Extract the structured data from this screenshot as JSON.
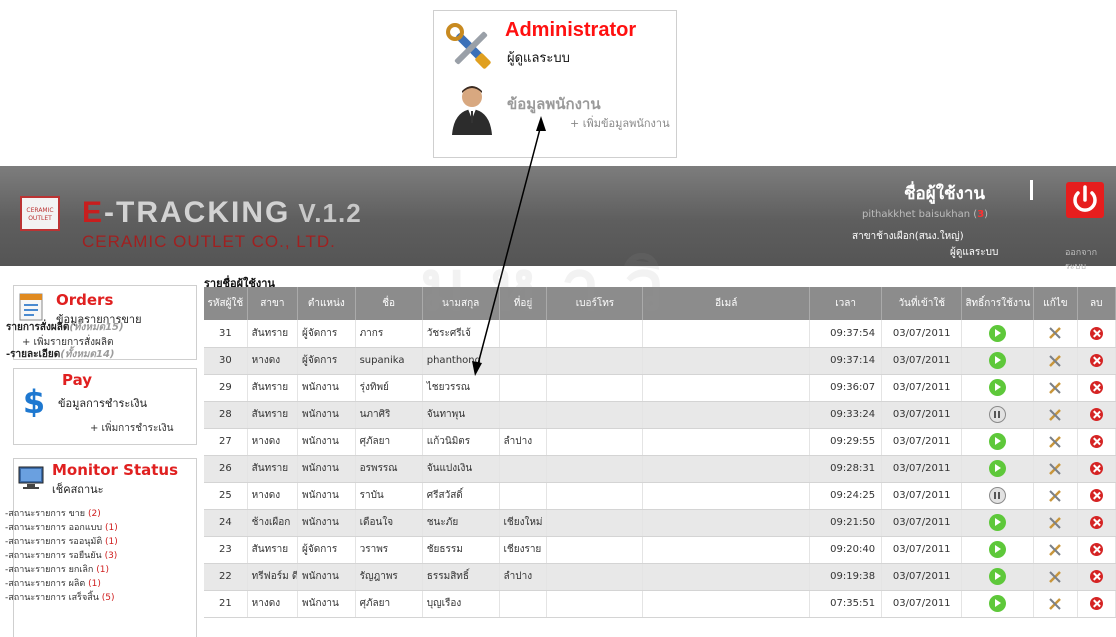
{
  "callout": {
    "admin_title": "Administrator",
    "admin_sub": "ผู้ดูแลระบบ",
    "emp_title": "ข้อมูลพนักงาน",
    "emp_add": "+ เพิ่มข้อมูลพนักงาน"
  },
  "header": {
    "brand_e": "E",
    "brand_rest": "-TRACKING",
    "version": "V.1.2",
    "company": "CERAMIC OUTLET CO., LTD.",
    "logo_text": "CERAMIC OUTLET",
    "username_label": "ชื่อผู้ใช้งาน",
    "username": "pithakkhet  baisukhan",
    "user_count": "3",
    "branch": "สาขาช้างเผือก(สนง.ใหญ่)",
    "role": "ผู้ดูแลระบบ",
    "logout": "ออกจากระบบ"
  },
  "sidebar": {
    "orders": {
      "title": "Orders",
      "sub": "ข้อมูลรายการขาย",
      "list": "รายการสั่งผลิต",
      "list_note": "(ทั้งหมด15)",
      "add": "+ เพิ่มรายการสั่งผลิต",
      "detail": "-รายละเอียด",
      "detail_note": "(ทั้งหมด14)"
    },
    "pay": {
      "title": "Pay",
      "sub": "ข้อมูลการชำระเงิน",
      "add": "+ เพิ่มการชำระเงิน"
    },
    "monitor": {
      "title": "Monitor Status",
      "sub": "เช็คสถานะ",
      "items": [
        {
          "label": "-สถานะรายการ ขาย",
          "count": "(2)"
        },
        {
          "label": "-สถานะรายการ ออกแบบ",
          "count": "(1)"
        },
        {
          "label": "-สถานะรายการ รออนุมัติ",
          "count": "(1)"
        },
        {
          "label": "-สถานะรายการ รอยืนยัน",
          "count": "(3)"
        },
        {
          "label": "-สถานะรายการ ยกเลิก",
          "count": "(1)"
        },
        {
          "label": "-สถานะรายการ ผลิต",
          "count": "(1)"
        },
        {
          "label": "-สถานะรายการ เสร็จสิ้น",
          "count": "(5)"
        }
      ]
    }
  },
  "table": {
    "title": "รายชื่อผู้ใช้งาน",
    "headers": [
      "รหัสผู้ใช้",
      "สาขา",
      "ตำแหน่ง",
      "ชื่อ",
      "นามสกุล",
      "ที่อยู่",
      "เบอร์โทร",
      "อีเมล์",
      "เวลา",
      "วันที่เข้าใช้",
      "สิทธิ์การใช้งาน",
      "แก้ไข",
      "ลบ"
    ],
    "rows": [
      {
        "id": "31",
        "branch": "สันทราย",
        "position": "ผู้จัดการ",
        "name": "ภากร",
        "surname": "วัชระศรีเจ้",
        "address": "",
        "time": "09:37:54",
        "date": "03/07/2011",
        "status": "on"
      },
      {
        "id": "30",
        "branch": "หางดง",
        "position": "ผู้จัดการ",
        "name": "supanika",
        "surname": "phanthong",
        "address": "",
        "time": "09:37:14",
        "date": "03/07/2011",
        "status": "on"
      },
      {
        "id": "29",
        "branch": "สันทราย",
        "position": "พนักงาน",
        "name": "รุ่งทิพย์",
        "surname": "ไชยวรรณ",
        "address": "",
        "time": "09:36:07",
        "date": "03/07/2011",
        "status": "on"
      },
      {
        "id": "28",
        "branch": "สันทราย",
        "position": "พนักงาน",
        "name": "นภาศิริ",
        "surname": "จันทาพุน",
        "address": "",
        "time": "09:33:24",
        "date": "03/07/2011",
        "status": "pause"
      },
      {
        "id": "27",
        "branch": "หางดง",
        "position": "พนักงาน",
        "name": "ศุภัลยา",
        "surname": "แก้วนิมิตร",
        "address": "ลำปาง",
        "time": "09:29:55",
        "date": "03/07/2011",
        "status": "on"
      },
      {
        "id": "26",
        "branch": "สันทราย",
        "position": "พนักงาน",
        "name": "อรพรรณ",
        "surname": "จันแปงเงิน",
        "address": "",
        "time": "09:28:31",
        "date": "03/07/2011",
        "status": "on"
      },
      {
        "id": "25",
        "branch": "หางดง",
        "position": "พนักงาน",
        "name": "ราบัน",
        "surname": "ศรีสวัสดิ์",
        "address": "",
        "time": "09:24:25",
        "date": "03/07/2011",
        "status": "pause"
      },
      {
        "id": "24",
        "branch": "ช้างเผือก",
        "position": "พนักงาน",
        "name": "เดือนใจ",
        "surname": "ชนะภัย",
        "address": "เชียงใหม่",
        "time": "09:21:50",
        "date": "03/07/2011",
        "status": "on"
      },
      {
        "id": "23",
        "branch": "สันทราย",
        "position": "ผู้จัดการ",
        "name": "วราพร",
        "surname": "ชัยธรรม",
        "address": "เชียงราย",
        "time": "09:20:40",
        "date": "03/07/2011",
        "status": "on"
      },
      {
        "id": "22",
        "branch": "ทรีฟอร์ม ดีชายน์",
        "position": "พนักงาน",
        "name": "รัญฎาพร",
        "surname": "ธรรมสิทธิ์",
        "address": "ลำปาง",
        "time": "09:19:38",
        "date": "03/07/2011",
        "status": "on"
      },
      {
        "id": "21",
        "branch": "หางดง",
        "position": "พนักงาน",
        "name": "ศุภัลยา",
        "surname": "บุญเรือง",
        "address": "",
        "time": "07:35:51",
        "date": "03/07/2011",
        "status": "on"
      }
    ]
  }
}
